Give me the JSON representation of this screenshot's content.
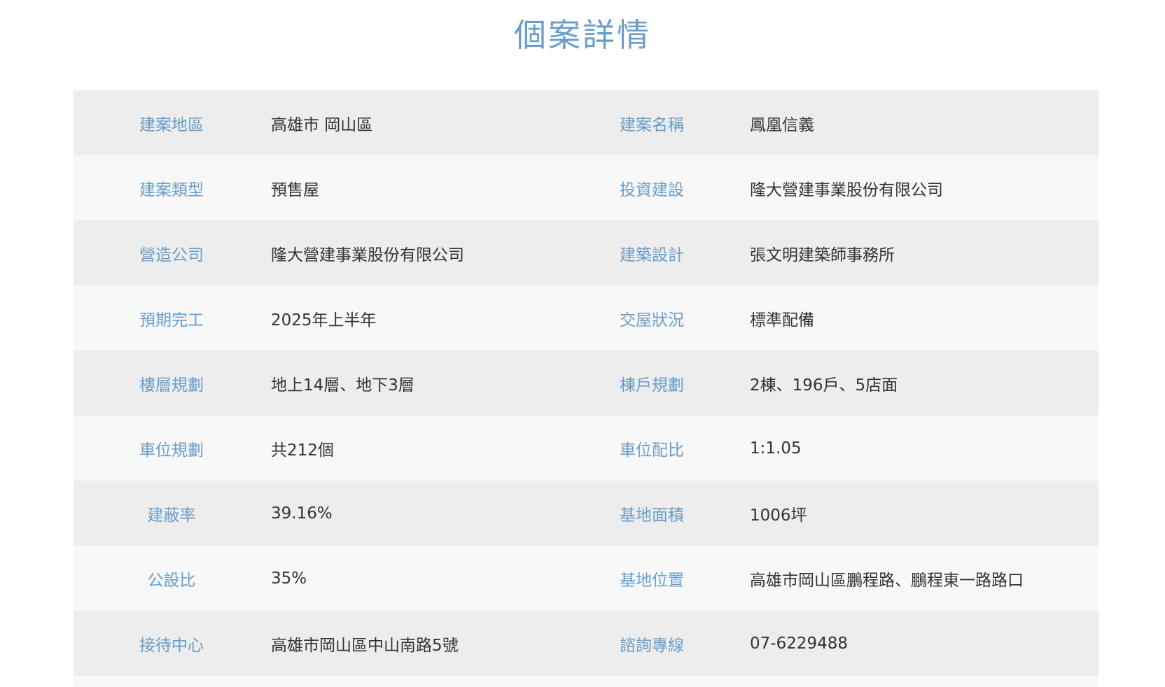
{
  "page": {
    "title": "個案詳情"
  },
  "details": {
    "rows": [
      [
        {
          "label": "建案地區",
          "value": "高雄市 岡山區"
        },
        {
          "label": "建案名稱",
          "value": "鳳凰信義"
        }
      ],
      [
        {
          "label": "建案類型",
          "value": "預售屋"
        },
        {
          "label": "投資建設",
          "value": "隆大營建事業股份有限公司"
        }
      ],
      [
        {
          "label": "營造公司",
          "value": "隆大營建事業股份有限公司"
        },
        {
          "label": "建築設計",
          "value": "張文明建築師事務所"
        }
      ],
      [
        {
          "label": "預期完工",
          "value": "2025年上半年"
        },
        {
          "label": "交屋狀況",
          "value": "標準配備"
        }
      ],
      [
        {
          "label": "樓層規劃",
          "value": "地上14層、地下3層"
        },
        {
          "label": "棟戶規劃",
          "value": "2棟、196戶、5店面"
        }
      ],
      [
        {
          "label": "車位規劃",
          "value": "共212個"
        },
        {
          "label": "車位配比",
          "value": "1:1.05"
        }
      ],
      [
        {
          "label": "建蔽率",
          "value": "39.16%"
        },
        {
          "label": "基地面積",
          "value": "1006坪"
        }
      ],
      [
        {
          "label": "公設比",
          "value": "35%"
        },
        {
          "label": "基地位置",
          "value": "高雄市岡山區鵬程路、鵬程東一路路口"
        }
      ],
      [
        {
          "label": "接待中心",
          "value": "高雄市岡山區中山南路5號"
        },
        {
          "label": "諮詢專線",
          "value": "07-6229488"
        }
      ]
    ]
  },
  "colors": {
    "label": "#6a9dc9",
    "value": "#333333",
    "row_odd": "#ededed",
    "row_even": "#f8f8f8"
  }
}
